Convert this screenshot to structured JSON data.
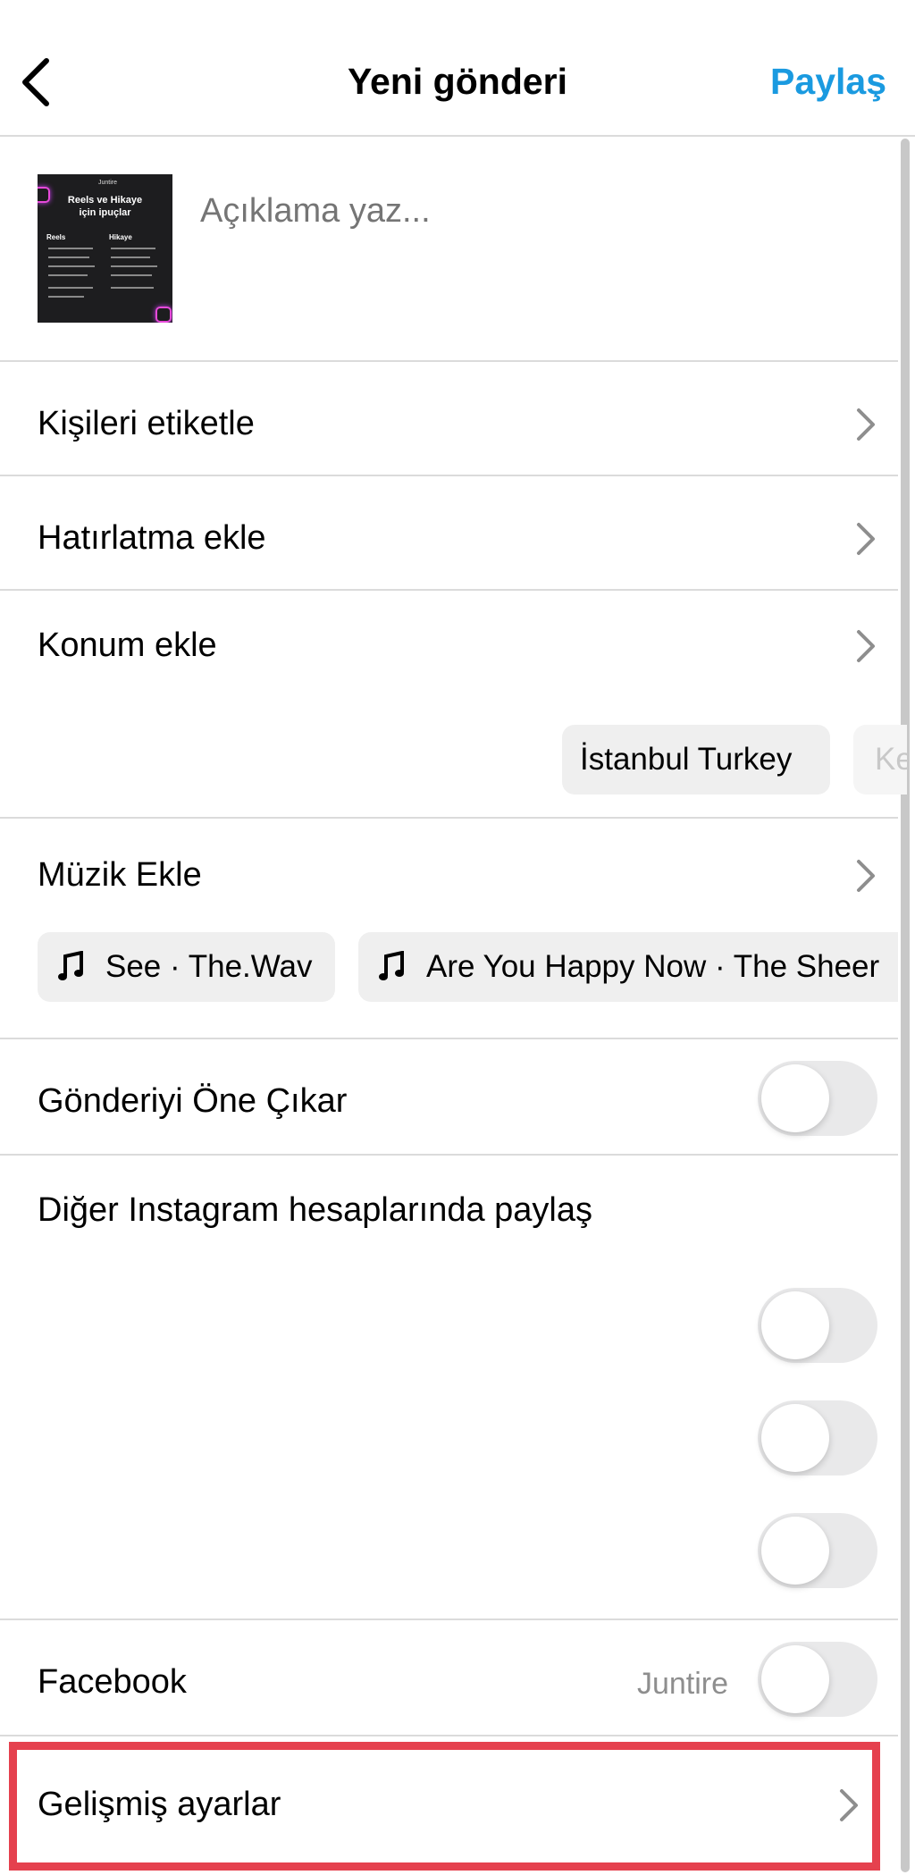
{
  "header": {
    "title": "Yeni gönderi",
    "share_label": "Paylaş"
  },
  "caption": {
    "placeholder": "Açıklama yaz...",
    "thumbnail": {
      "brand": "Juntire",
      "title_line1": "Reels ve Hikaye",
      "title_line2": "için ipuçlar",
      "col1": "Reels",
      "col2": "Hikaye"
    }
  },
  "rows": {
    "tag_people": "Kişileri etiketle",
    "add_reminder": "Hatırlatma ekle",
    "add_location": "Konum ekle",
    "add_music": "Müzik Ekle",
    "feature_post": "Gönderiyi Öne Çıkar",
    "share_other_accounts": "Diğer Instagram hesaplarında paylaş",
    "facebook": "Facebook",
    "facebook_account": "Juntire",
    "advanced_settings": "Gelişmiş ayarlar"
  },
  "location_suggestions": [
    "İstanbul Turkey",
    "Ke"
  ],
  "music_suggestions": [
    "See · The.Wav",
    "Are You Happy Now · The Sheer"
  ],
  "toggles": {
    "feature_post": false,
    "account_1": false,
    "account_2": false,
    "account_3": false,
    "facebook": false
  },
  "colors": {
    "accent": "#1a9ae0",
    "highlight_border": "#e5414e",
    "toggle_off": "#e9e9ea"
  }
}
